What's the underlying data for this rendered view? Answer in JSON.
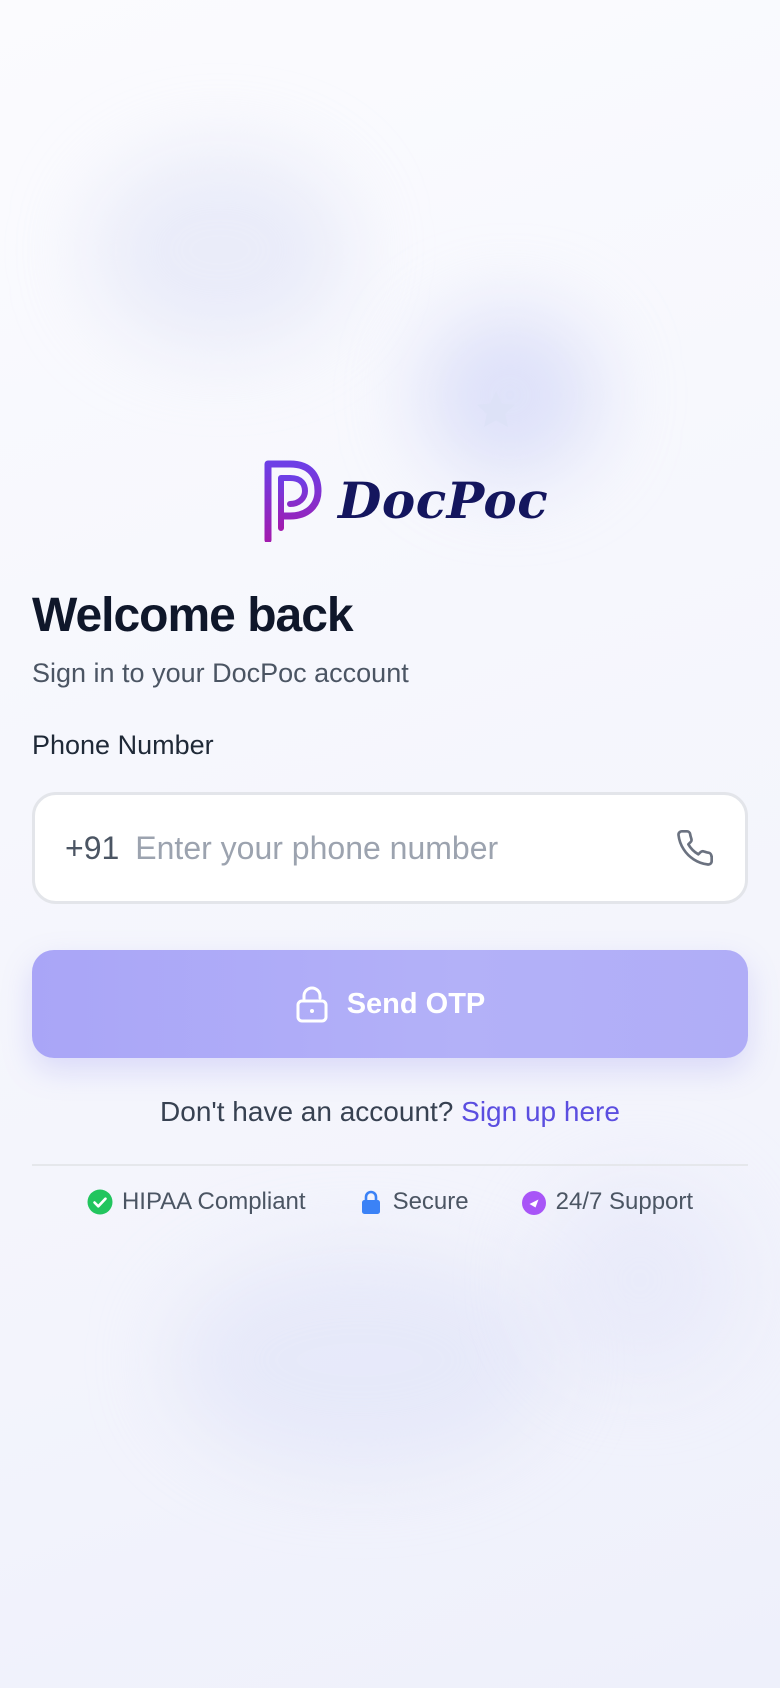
{
  "brand": {
    "name": "DocPoc",
    "colors": {
      "logo_purple": "#7c3aed",
      "logo_magenta": "#a21caf",
      "wordmark": "#14165e",
      "accent": "#5b4ee0",
      "button": "#aeabf7"
    }
  },
  "decor": {
    "star_icon": "star-icon"
  },
  "login": {
    "title": "Welcome back",
    "subtitle": "Sign in to your DocPoc account",
    "phone_label": "Phone Number",
    "country_code": "+91",
    "phone_placeholder": "Enter your phone number",
    "phone_value": "",
    "phone_icon": "phone-icon",
    "send_button": {
      "label": "Send OTP",
      "icon": "lock-icon"
    },
    "signup_prompt": "Don't have an account?",
    "signup_link": "Sign up here"
  },
  "badges": [
    {
      "label": "HIPAA Compliant",
      "icon": "check-circle-icon",
      "color": "#22c55e"
    },
    {
      "label": "Secure",
      "icon": "lock-icon",
      "color": "#3b82f6"
    },
    {
      "label": "24/7 Support",
      "icon": "support-icon",
      "color": "#a855f7"
    }
  ]
}
